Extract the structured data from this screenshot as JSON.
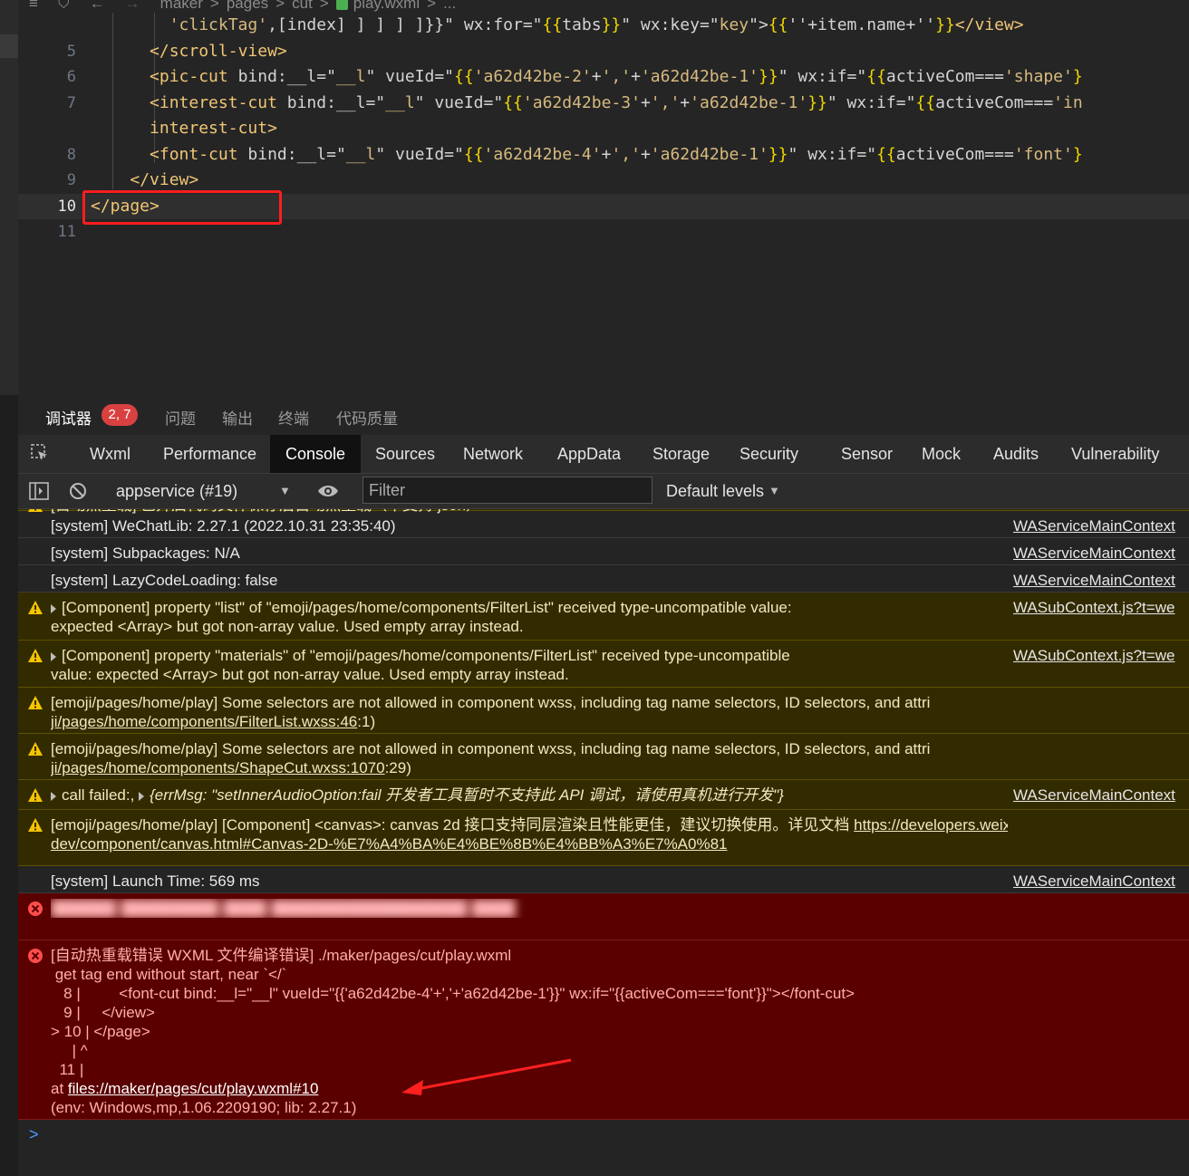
{
  "editor": {
    "breadcrumb": [
      "maker",
      ">",
      "pages",
      ">",
      "cut",
      ">",
      "play.wxml",
      ">",
      "..."
    ],
    "lines": [
      {
        "num": "",
        "html": "        <span class=\"str\">'clickTag'</span>,[index] ] ] ] ]}}\" wx:for=\"<span class=\"brace\">{{</span>tabs<span class=\"brace\">}}</span>\" wx:key=\"<span class=\"str\">key</span>\"><span class=\"brace\">{{</span>''+item.name+''<span class=\"brace\">}}</span><span class=\"tag\">&lt;/view&gt;</span>"
      },
      {
        "num": "5",
        "html": "      <span class=\"tag\">&lt;/scroll-view&gt;</span>"
      },
      {
        "num": "6",
        "html": "      <span class=\"tag\">&lt;pic-cut</span> bind:__l=\"<span class=\"str\">__l</span>\" vueId=\"<span class=\"brace\">{{</span><span class=\"str\">'a62d42be-2'</span>+<span class=\"str\">','</span>+<span class=\"str\">'a62d42be-1'</span><span class=\"brace\">}}</span>\" wx:if=\"<span class=\"brace\">{{</span>activeCom===<span class=\"str\">'shape'</span><span class=\"brace\">}</span>"
      },
      {
        "num": "7",
        "html": "      <span class=\"tag\">&lt;interest-cut</span> bind:__l=\"<span class=\"str\">__l</span>\" vueId=\"<span class=\"brace\">{{</span><span class=\"str\">'a62d42be-3'</span>+<span class=\"str\">','</span>+<span class=\"str\">'a62d42be-1'</span><span class=\"brace\">}}</span>\" wx:if=\"<span class=\"brace\">{{</span>activeCom===<span class=\"str\">'in</span>"
      },
      {
        "num": "",
        "html": "      <span class=\"tag\">interest-cut&gt;</span>"
      },
      {
        "num": "8",
        "html": "      <span class=\"tag\">&lt;font-cut</span> bind:__l=\"<span class=\"str\">__l</span>\" vueId=\"<span class=\"brace\">{{</span><span class=\"str\">'a62d42be-4'</span>+<span class=\"str\">','</span>+<span class=\"str\">'a62d42be-1'</span><span class=\"brace\">}}</span>\" wx:if=\"<span class=\"brace\">{{</span>activeCom===<span class=\"str\">'font'</span><span class=\"brace\">}</span>"
      },
      {
        "num": "9",
        "html": "    <span class=\"tag\">&lt;/view&gt;</span>"
      },
      {
        "num": "10",
        "html": "<span class=\"tag\">&lt;/page&gt;</span>",
        "active": true
      },
      {
        "num": "11",
        "html": ""
      }
    ]
  },
  "panel_tabs": {
    "debugger": "调试器",
    "badge": "2, 7",
    "issues": "问题",
    "output": "输出",
    "terminal": "终端",
    "code_quality": "代码质量"
  },
  "devtools_tabs": [
    "Wxml",
    "Performance",
    "Console",
    "Sources",
    "Network",
    "AppData",
    "Storage",
    "Security",
    "Sensor",
    "Mock",
    "Audits",
    "Vulnerability"
  ],
  "toolbar": {
    "context": "appservice (#19)",
    "filter_placeholder": "Filter",
    "levels": "Default levels"
  },
  "console": {
    "messages": [
      {
        "type": "warn",
        "text": "[自动热重载] 已开启代码文件保存后自动热重载（不支持 json）",
        "source": ""
      },
      {
        "type": "log",
        "text": "[system] WeChatLib: 2.27.1 (2022.10.31 23:35:40)",
        "source": "WAServiceMainContext"
      },
      {
        "type": "log",
        "text": "[system] Subpackages: N/A",
        "source": "WAServiceMainContext"
      },
      {
        "type": "log",
        "text": "[system] LazyCodeLoading: false",
        "source": "WAServiceMainContext"
      },
      {
        "type": "warn",
        "text": "[Component] property \"list\" of \"emoji/pages/home/components/FilterList\" received type-uncompatible value:\nexpected <Array> but got non-array value. Used empty array instead.",
        "source": "WASubContext.js?t=we",
        "expand": true
      },
      {
        "type": "warn",
        "text": "[Component] property \"materials\" of \"emoji/pages/home/components/FilterList\" received type-uncompatible\nvalue: expected <Array> but got non-array value. Used empty array instead.",
        "source": "WASubContext.js?t=we",
        "expand": true
      },
      {
        "type": "warn",
        "text": "[emoji/pages/home/play] Some selectors are not allowed in component wxss, including tag name selectors, ID selectors, and attri",
        "line2": "ji/pages/home/components/FilterList.wxss:46",
        "line2_tail": ":1)",
        "source": ""
      },
      {
        "type": "warn",
        "text": "[emoji/pages/home/play] Some selectors are not allowed in component wxss, including tag name selectors, ID selectors, and attri",
        "line2": "ji/pages/home/components/ShapeCut.wxss:1070",
        "line2_tail": ":29)",
        "source": ""
      },
      {
        "type": "warn",
        "text": "call failed:,",
        "errmsg": "{errMsg: \"setInnerAudioOption:fail 开发者工具暂时不支持此 API 调试，请使用真机进行开发\"}",
        "source": "WAServiceMainContext",
        "expand": true
      },
      {
        "type": "warn",
        "text": "[emoji/pages/home/play] [Component] <canvas>: canvas 2d 接口支持同层渲染且性能更佳，建议切换使用。详见文档 ",
        "doc_link": "https://developers.weixin",
        "line2": "dev/component/canvas.html#Canvas-2D-%E7%A4%BA%E4%BE%8B%E4%BB%A3%E7%A0%81",
        "source": ""
      },
      {
        "type": "log",
        "text": "[system] Launch Time: 569 ms",
        "source": "WAServiceMainContext"
      },
      {
        "type": "err",
        "text": "██████ █████████ ████ ██████████████████ ████",
        "blurred": true
      },
      {
        "type": "err",
        "text": "[自动热重载错误 WXML 文件编译错误] ./maker/pages/cut/play.wxml\n get tag end without start, near `</`\n   8 |         <font-cut bind:__l=\"__l\" vueId=\"{{'a62d42be-4'+','+'a62d42be-1'}}\" wx:if=\"{{activeCom==='font'}}\"></font-cut>\n   9 |     </view>\n> 10 | </page>\n     | ^\n  11 |",
        "at_prefix": "at ",
        "at_link": "files://maker/pages/cut/play.wxml#10",
        "env": "(env: Windows,mp,1.06.2209190; lib: 2.27.1)"
      }
    ],
    "prompt": ">"
  }
}
